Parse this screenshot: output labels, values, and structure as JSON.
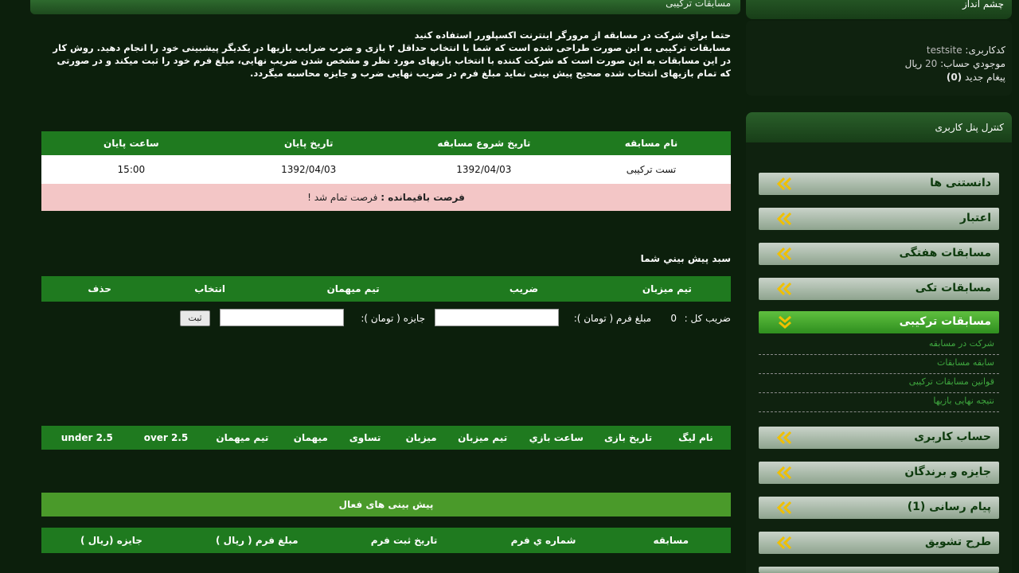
{
  "main": {
    "header_title": "مسابقات ترکیبی",
    "intro_lines": [
      "حتما براي شرکت در مسابقه از مرورگر اینترنت اکسپلورر استفاده کنید",
      "مسابقات ترکیبی به این صورت طراحی شده است که شما با انتخاب حداقل ۲ بازی و ضرب ضرایب بازیها در یکدیگر پیشبینی خود را انجام دهید. روش کار در این مسابقات به این صورت است که شرکت کننده با انتخاب بازیهای مورد نظر و مشخص شدن ضریب نهایی، مبلغ فرم خود را ثبت میکند و در صورتی که تمام بازیهای انتخاب شده صحیح پیش بینی نماید مبلغ فرم در ضریب نهایی ضرب و جایزه محاسبه میگردد."
    ],
    "contest_table": {
      "headers": [
        "نام مسابقه",
        "تاریخ شروع مسابقه",
        "تاریخ پایان",
        "ساعت پایان"
      ],
      "row": [
        "تست ترکیبی",
        "1392/04/03",
        "1392/04/03",
        "15:00"
      ],
      "remaining_label": "فرصت باقیمانده :",
      "remaining_value": "فرصت تمام شد !"
    },
    "basket": {
      "title": "سبد پیش بيني شما",
      "headers": [
        "تیم میزبان",
        "ضریب",
        "تیم میهمان",
        "انتخاب",
        "حذف"
      ],
      "total_coef_label": "ضریب کل :",
      "total_coef_value": "0",
      "form_amount_label": "مبلغ فرم ( تومان ):",
      "prize_label": "جایزه ( تومان ):",
      "submit_label": "ثبت"
    },
    "games_headers": [
      "نام لیگ",
      "تاریخ بازی",
      "ساعت بازي",
      "تیم میزبان",
      "میزبان",
      "تساوی",
      "میهمان",
      "تیم میهمان",
      "over 2.5",
      "under 2.5"
    ],
    "active_predictions_title": "پیش بینی های فعال",
    "predictions_headers": [
      "مسابقه",
      "شماره ي فرم",
      "تاریخ ثبت فرم",
      "مبلغ فرم ( ریال )",
      "جایزه (ریال )"
    ]
  },
  "sidebar": {
    "outlook_title": "چشم انداز",
    "username_label": "کدکاربری:",
    "username": "testsite",
    "balance_label": "موجودي حساب:",
    "balance_value": "20",
    "balance_unit": "ريال",
    "messages_label": "پیغام جدید",
    "messages_count": "(0)",
    "panel_title": "کنترل پنل کاربری",
    "menu": [
      {
        "label": "دانستنی ها",
        "active": false
      },
      {
        "label": "اعتبار",
        "active": false
      },
      {
        "label": "مسابقات هفتگی",
        "active": false
      },
      {
        "label": "مسابقات تکی",
        "active": false
      },
      {
        "label": "مسابقات ترکیبی",
        "active": true
      }
    ],
    "submenu": [
      "شرکت در مسابقه",
      "سابقه مسابقات",
      "قوانین مسابقات ترکیبی",
      "نتیجه نهایی بازیها"
    ],
    "menu2": [
      {
        "label": "حساب کاربری"
      },
      {
        "label": "جایزه و برندگان"
      },
      {
        "label": "پیام رسانی (1)"
      },
      {
        "label": "طرح تشویق"
      }
    ]
  },
  "colors": {
    "page_bg": "#0c1f0c",
    "table_header": "#1f7a1f",
    "bar_green": "#4a9a2a",
    "pink_row": "#f3c6c6",
    "accent_yellow": "#f0c000"
  }
}
